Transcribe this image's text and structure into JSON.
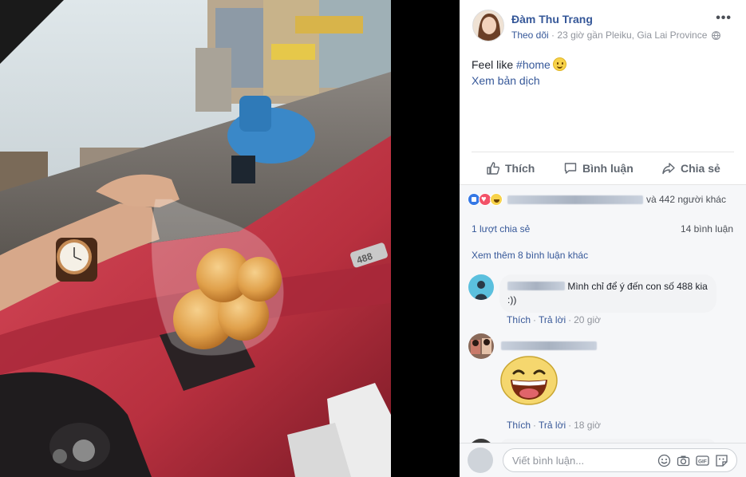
{
  "photo": {
    "dashboard_badge": "488"
  },
  "post": {
    "author": "Đàm Thu Trang",
    "follow": "Theo dõi",
    "meta_separator": "·",
    "time_location": "23 giờ gần Pleiku, Gia Lai Province",
    "privacy_icon": "globe-icon",
    "more_icon": "•••",
    "text_prefix": "Feel like ",
    "hashtag": "#home",
    "translate": "Xem bản dịch"
  },
  "actions": {
    "like": "Thích",
    "comment": "Bình luận",
    "share": "Chia sẻ"
  },
  "feedback": {
    "reactions": [
      "like-icon",
      "love-icon",
      "haha-icon"
    ],
    "reactors_suffix": "và 442 người khác",
    "shares": "1 lượt chia sẻ",
    "comments": "14 bình luận",
    "more_comments": "Xem thêm 8 bình luận khác"
  },
  "comments": [
    {
      "text": "Mình chỉ để ý đến con số 488 kia :))",
      "like": "Thích",
      "reply": "Trả lời",
      "time": "20 giờ"
    },
    {
      "sticker": "laughing-sticker",
      "like": "Thích",
      "reply": "Trả lời",
      "time": "18 giờ"
    }
  ],
  "compose": {
    "placeholder": "Viết bình luận...",
    "icons": [
      "emoji-icon",
      "camera-icon",
      "gif-icon",
      "sticker-icon"
    ]
  },
  "colors": {
    "link": "#365899",
    "muted": "#90949c",
    "like_blue": "#3578e5",
    "love_red": "#f25268",
    "haha_yellow": "#f7d24a"
  }
}
